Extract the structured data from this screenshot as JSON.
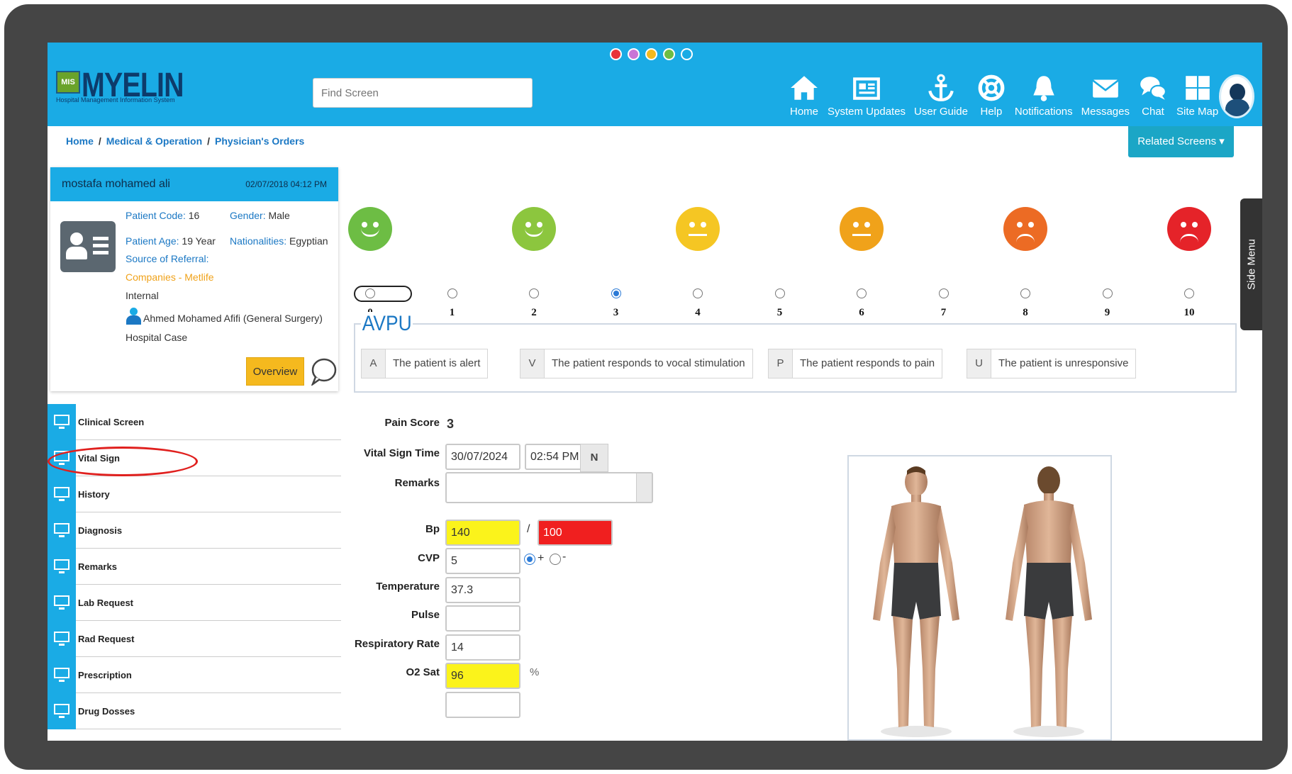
{
  "header": {
    "logo_text": "MYELIN",
    "logo_mark": "MIS",
    "logo_subtitle": "Hospital Management Information System",
    "search_placeholder": "Find Screen",
    "nav": [
      {
        "label": "Home",
        "icon": "home-icon"
      },
      {
        "label": "System Updates",
        "icon": "newspaper-icon"
      },
      {
        "label": "User Guide",
        "icon": "anchor-icon"
      },
      {
        "label": "Help",
        "icon": "lifebuoy-icon"
      },
      {
        "label": "Notifications",
        "icon": "bell-icon"
      },
      {
        "label": "Messages",
        "icon": "envelope-icon"
      },
      {
        "label": "Chat",
        "icon": "chat-icon"
      },
      {
        "label": "Site Map",
        "icon": "grid-icon"
      }
    ],
    "theme_dots": [
      "#e8343a",
      "#c975d6",
      "#f5b91e",
      "#6dbd44",
      "#1aabe5"
    ]
  },
  "breadcrumb": {
    "home": "Home",
    "section": "Medical & Operation",
    "page": "Physician's Orders",
    "separator": "/"
  },
  "related_screens": "Related Screens",
  "patient": {
    "name": "mostafa mohamed ali",
    "date": "02/07/2018 04:12 PM",
    "code_label": "Patient Code:",
    "code": "16",
    "gender_label": "Gender:",
    "gender": "Male",
    "age_label": "Patient Age:",
    "age": "19 Year",
    "nationality_label": "Nationalities:",
    "nationality": "Egyptian",
    "referral_label": "Source of Referral:",
    "referral_value": "Companies - Metlife",
    "referral_type": "Internal",
    "doctor": "Ahmed Mohamed Afifi (General Surgery)",
    "case_type": "Hospital Case",
    "overview_label": "Overview"
  },
  "menu": [
    {
      "label": "Clinical Screen"
    },
    {
      "label": "Vital Sign"
    },
    {
      "label": "History"
    },
    {
      "label": "Diagnosis"
    },
    {
      "label": "Remarks"
    },
    {
      "label": "Lab Request"
    },
    {
      "label": "Rad Request"
    },
    {
      "label": "Prescription"
    },
    {
      "label": "Drug Dosses"
    }
  ],
  "pain_scale": {
    "values": [
      "0",
      "1",
      "2",
      "3",
      "4",
      "5",
      "6",
      "7",
      "8",
      "9",
      "10"
    ],
    "selected": "3",
    "faces": [
      {
        "at": "0",
        "color": "#6dbd44",
        "mood": "happy"
      },
      {
        "at": "2",
        "color": "#8cc63e",
        "mood": "happy"
      },
      {
        "at": "4",
        "color": "#f5c623",
        "mood": "neutral"
      },
      {
        "at": "6",
        "color": "#f0a21a",
        "mood": "neutral"
      },
      {
        "at": "8",
        "color": "#ec6b24",
        "mood": "sad"
      },
      {
        "at": "10",
        "color": "#e52329",
        "mood": "crying"
      }
    ]
  },
  "avpu": {
    "title": "AVPU",
    "options": [
      {
        "letter": "A",
        "text": "The patient is alert"
      },
      {
        "letter": "V",
        "text": "The patient responds to vocal stimulation"
      },
      {
        "letter": "P",
        "text": "The patient responds to pain"
      },
      {
        "letter": "U",
        "text": "The patient is unresponsive"
      }
    ]
  },
  "form": {
    "pain_score_label": "Pain Score",
    "pain_score": "3",
    "time_label": "Vital Sign Time",
    "date": "30/07/2024",
    "time": "02:54 PM",
    "now_button": "N",
    "remarks_label": "Remarks",
    "remarks": "",
    "bp_label": "Bp",
    "bp_systolic": "140",
    "bp_separator": "/",
    "bp_diastolic": "100",
    "cvp_label": "CVP",
    "cvp": "5",
    "cvp_plus": "+",
    "cvp_minus": "-",
    "cvp_sign": "+",
    "temperature_label": "Temperature",
    "temperature": "37.3",
    "pulse_label": "Pulse",
    "pulse": "",
    "resp_label": "Respiratory Rate",
    "resp": "14",
    "o2_label": "O2 Sat",
    "o2": "96",
    "o2_unit": "%"
  },
  "side_menu": "Side Menu"
}
